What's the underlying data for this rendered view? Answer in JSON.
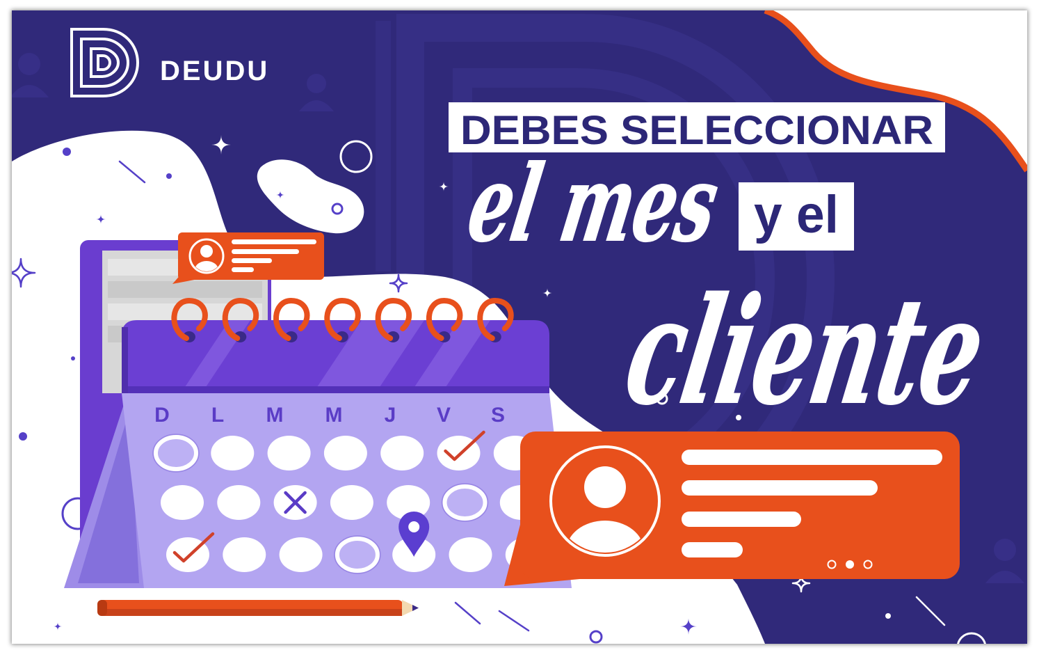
{
  "brand": {
    "name": "DEUDU",
    "logo_icon": "deudu-d-logo-icon"
  },
  "headline": {
    "line1": "DEBES SELECCIONAR",
    "script_1": "el mes",
    "boxed_2": "y el",
    "script_2": "cliente"
  },
  "calendar": {
    "weekdays": [
      "D",
      "L",
      "M",
      "M",
      "J",
      "V",
      "S"
    ],
    "rows": [
      [
        "outlined",
        "filled",
        "filled",
        "filled",
        "filled",
        "check",
        "filled"
      ],
      [
        "filled",
        "filled",
        "cross",
        "filled",
        "filled",
        "outlined",
        "filled"
      ],
      [
        "check",
        "filled",
        "filled",
        "outlined",
        "pin",
        "filled",
        "filled"
      ]
    ],
    "ring_count": 7
  },
  "chat_bubbles": {
    "small": {
      "avatar_icon": "user-avatar-icon"
    },
    "large": {
      "avatar_icon": "user-avatar-icon",
      "pager": {
        "count": 3,
        "active": 2
      }
    }
  },
  "icons": {
    "pencil": "pencil-icon",
    "check": "check-icon",
    "cross": "x-mark-icon",
    "pin": "location-pin-icon",
    "sparkle": "sparkle-icon"
  },
  "colors": {
    "background": "#30297a",
    "accent": "#e8501c",
    "calendar_header": "#6b3fd3",
    "calendar_body": "#b3a5f1",
    "headline_ink": "#2c2777",
    "weekday_ink": "#5a3cc6",
    "decoration": "#5540c8"
  }
}
